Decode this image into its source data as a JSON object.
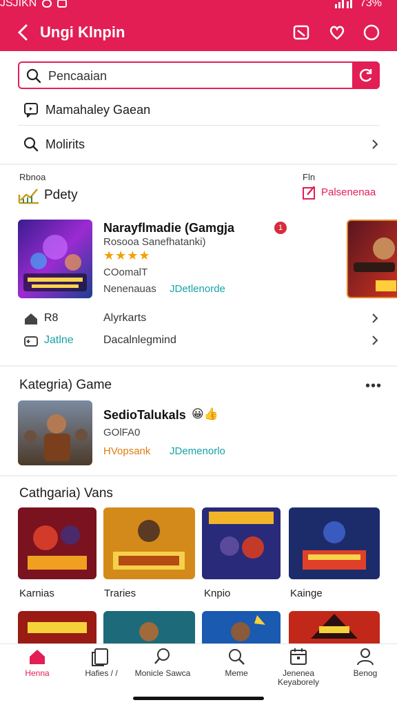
{
  "status_bar": {
    "left_text": "JSJIKN",
    "right_text": "73%"
  },
  "app_bar": {
    "title": "Ungi Klnpin"
  },
  "search": {
    "placeholder": "Pencaaian"
  },
  "list": [
    {
      "label": "Mamahaley Gaean",
      "icon": "chat-icon"
    },
    {
      "label": "Molirits",
      "icon": "search-icon"
    }
  ],
  "featured": {
    "left_small": "Rbnoa",
    "left_title": "Pdety",
    "right_small": "Fln",
    "right_link": "Palsenenaa",
    "card": {
      "title": "Narayflmadie (Gamgja",
      "subtitle": "Rosooa Sanefhatanki)",
      "rating": "★★★★",
      "meta": "COomalT",
      "left_tag": "Nenenauas",
      "right_tag": "JDetlenorde",
      "badge": "1"
    },
    "rows": [
      {
        "key": "R8",
        "value": "Alyrkarts",
        "icon": "home-icon"
      },
      {
        "key": "Jatlne",
        "value": "Dacalnlegmind",
        "icon": "gamepad-icon"
      }
    ]
  },
  "category_game": {
    "title": "Kategria) Game",
    "card": {
      "title": "SedioTalukals",
      "emoji": "😀👍",
      "meta": "GOlFA0",
      "left_tag": "HVopsank",
      "right_tag": "JDemenorlo"
    }
  },
  "category_vans": {
    "title": "Cathgaria) Vans",
    "items": [
      {
        "label": "Karnias",
        "art_text": ""
      },
      {
        "label": "Traries",
        "art_text": ""
      },
      {
        "label": "Knpio",
        "art_text": ""
      },
      {
        "label": "Kainge",
        "art_text": ""
      }
    ]
  },
  "bottom_nav": [
    {
      "label": "Henna",
      "icon": "home-icon",
      "active": true
    },
    {
      "label": "Hafies /  /",
      "icon": "book-icon",
      "active": false
    },
    {
      "label": "Monicle Sawca",
      "icon": "search-icon",
      "active": false
    },
    {
      "label": "Meme",
      "icon": "search-icon",
      "active": false
    },
    {
      "label": "Jenenea Keyaborely",
      "icon": "calendar-icon",
      "active": false
    },
    {
      "label": "Benog",
      "icon": "profile-icon",
      "active": false
    }
  ],
  "colors": {
    "brand": "#e21e55",
    "teal": "#16a3a6",
    "orange": "#e07a10"
  }
}
